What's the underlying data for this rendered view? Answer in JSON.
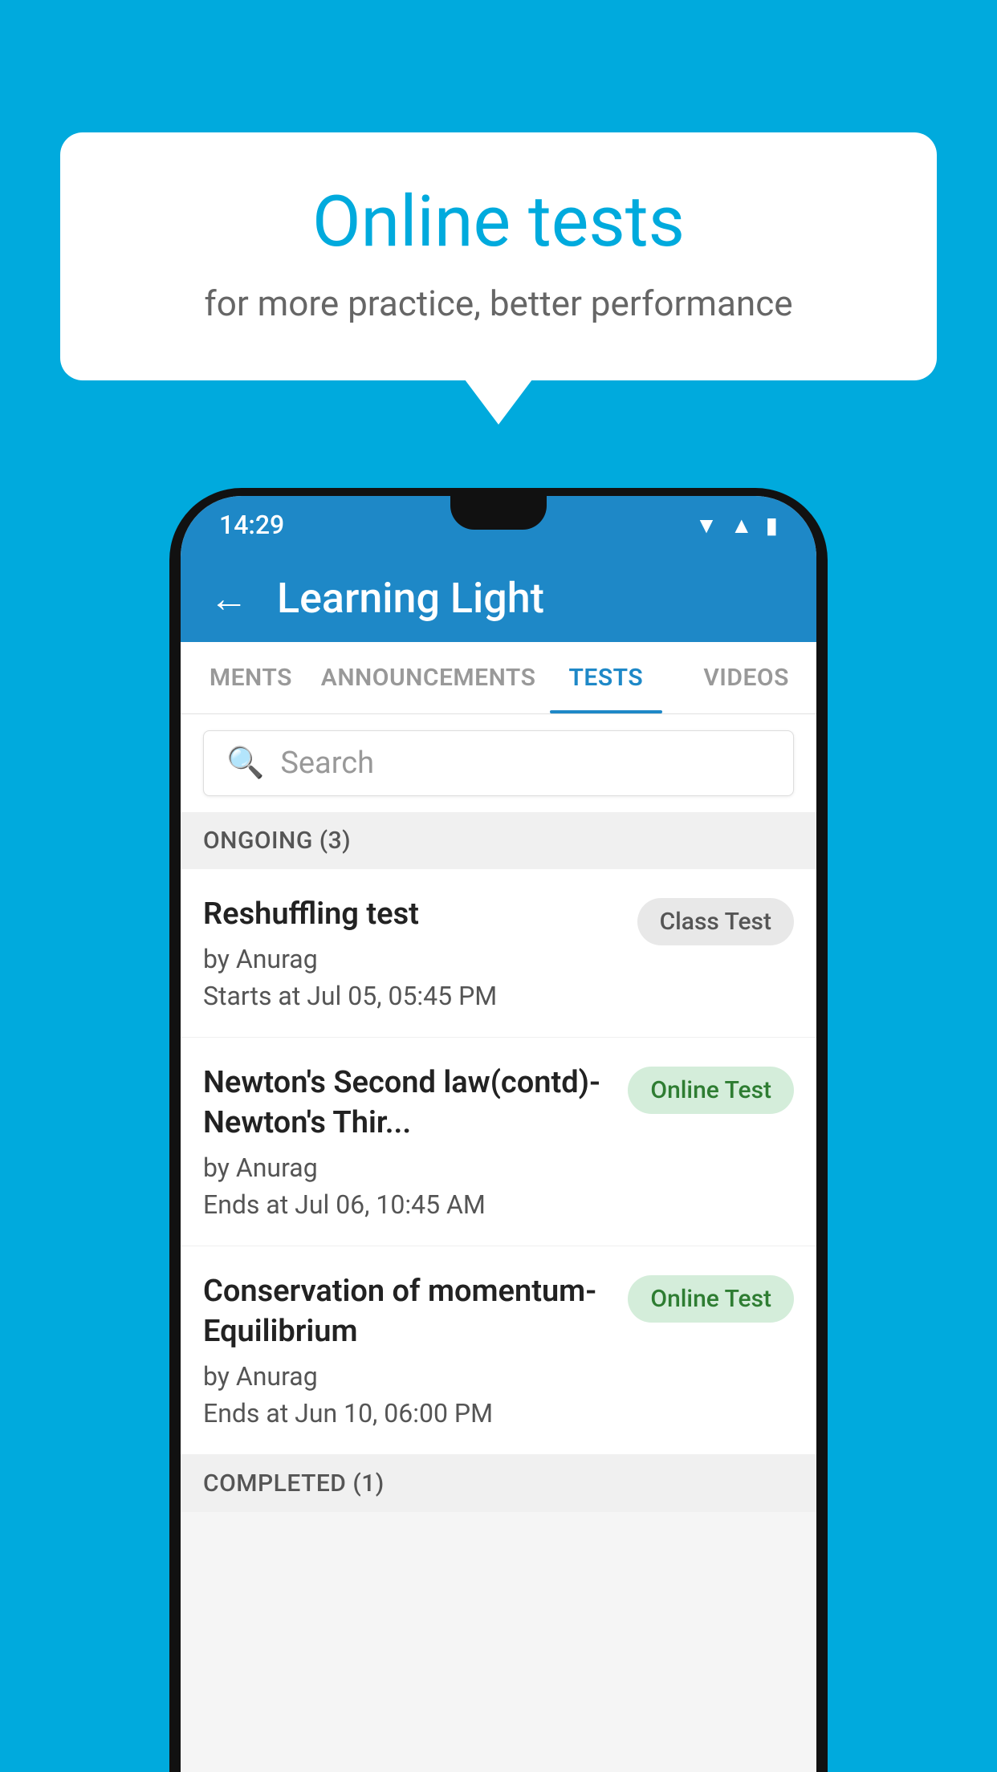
{
  "background": {
    "color": "#00AADD"
  },
  "speech_bubble": {
    "title": "Online tests",
    "subtitle": "for more practice, better performance"
  },
  "phone": {
    "status_bar": {
      "time": "14:29",
      "icons": [
        "wifi",
        "signal",
        "battery"
      ]
    },
    "app_bar": {
      "back_label": "←",
      "title": "Learning Light"
    },
    "tabs": [
      {
        "label": "MENTS",
        "active": false
      },
      {
        "label": "ANNOUNCEMENTS",
        "active": false
      },
      {
        "label": "TESTS",
        "active": true
      },
      {
        "label": "VIDEOS",
        "active": false
      }
    ],
    "search": {
      "placeholder": "Search"
    },
    "ongoing_section": {
      "header": "ONGOING (3)",
      "tests": [
        {
          "name": "Reshuffling test",
          "by": "by Anurag",
          "date": "Starts at  Jul 05, 05:45 PM",
          "badge": "Class Test",
          "badge_type": "class"
        },
        {
          "name": "Newton's Second law(contd)-Newton's Thir...",
          "by": "by Anurag",
          "date": "Ends at  Jul 06, 10:45 AM",
          "badge": "Online Test",
          "badge_type": "online"
        },
        {
          "name": "Conservation of momentum-Equilibrium",
          "by": "by Anurag",
          "date": "Ends at  Jun 10, 06:00 PM",
          "badge": "Online Test",
          "badge_type": "online"
        }
      ]
    },
    "completed_section": {
      "header": "COMPLETED (1)"
    }
  }
}
